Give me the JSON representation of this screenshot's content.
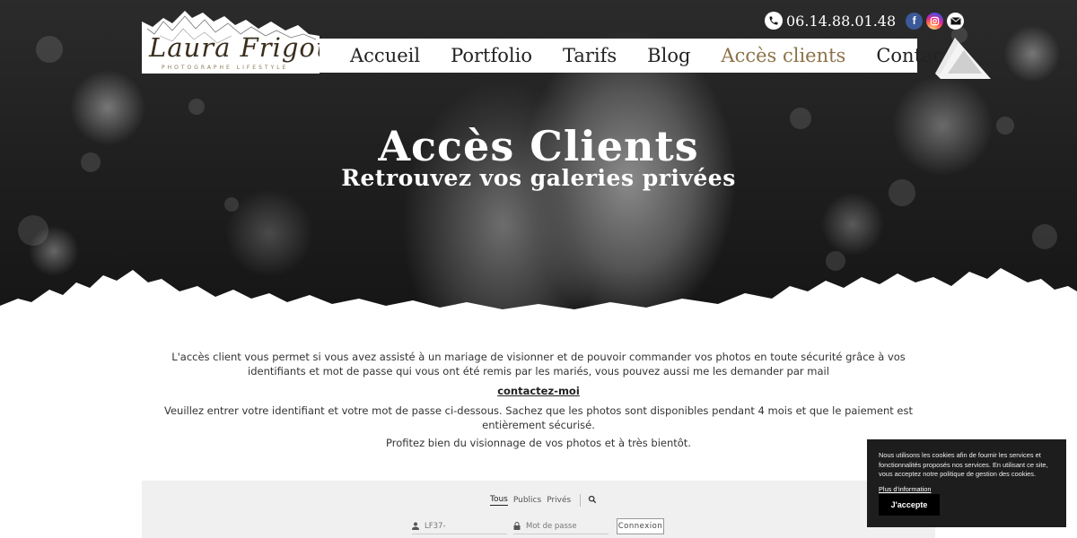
{
  "header": {
    "logo": {
      "name": "Laura Frigout",
      "tagline": "PHOTOGRAPHE   LIFESTYLE"
    },
    "contact_bar": {
      "phone": "06.14.88.01.48",
      "icons": [
        "phone-icon",
        "facebook-icon",
        "instagram-icon",
        "mail-icon"
      ]
    },
    "nav": [
      {
        "label": "Accueil",
        "active": false
      },
      {
        "label": "Portfolio",
        "active": false
      },
      {
        "label": "Tarifs",
        "active": false
      },
      {
        "label": "Blog",
        "active": false
      },
      {
        "label": "Accès clients",
        "active": true
      },
      {
        "label": "Contact",
        "active": false
      }
    ]
  },
  "hero": {
    "title": "Accès Clients",
    "subtitle": "Retrouvez vos galeries privées"
  },
  "content": {
    "intro": "L'accès client vous permet si vous avez assisté à un mariage de visionner et de pouvoir commander vos photos en toute sécurité grâce à vos identifiants et mot de passe qui vous ont été remis par les mariés, vous pouvez aussi me les demander par mail",
    "contact_link": "contactez-moi",
    "instructions": "Veuillez entrer votre identifiant et votre mot de passe ci-dessous. Sachez que les photos sont disponibles pendant 4 mois et que le paiement est entièrement sécurisé.",
    "closing": "Profitez bien du visionnage de vos photos et à très bientôt."
  },
  "login": {
    "tabs": [
      {
        "label": "Tous",
        "active": true
      },
      {
        "label": "Publics",
        "active": false
      },
      {
        "label": "Privés",
        "active": false
      }
    ],
    "username_placeholder": "LF37-",
    "password_placeholder": "Mot de passe",
    "submit_label": "Connexion"
  },
  "cookie_banner": {
    "text": "Nous utilisons les cookies afin de fournir les services et fonctionnalités proposés nos services. En utilisant ce site, vous acceptez notre politique de gestion des cookies.",
    "link": "Plus d'information",
    "accept_label": "J'accepte"
  },
  "colors": {
    "accent": "#8c7249",
    "cookie_bg": "#1d1d1d",
    "panel_bg": "#f0f0f0"
  }
}
